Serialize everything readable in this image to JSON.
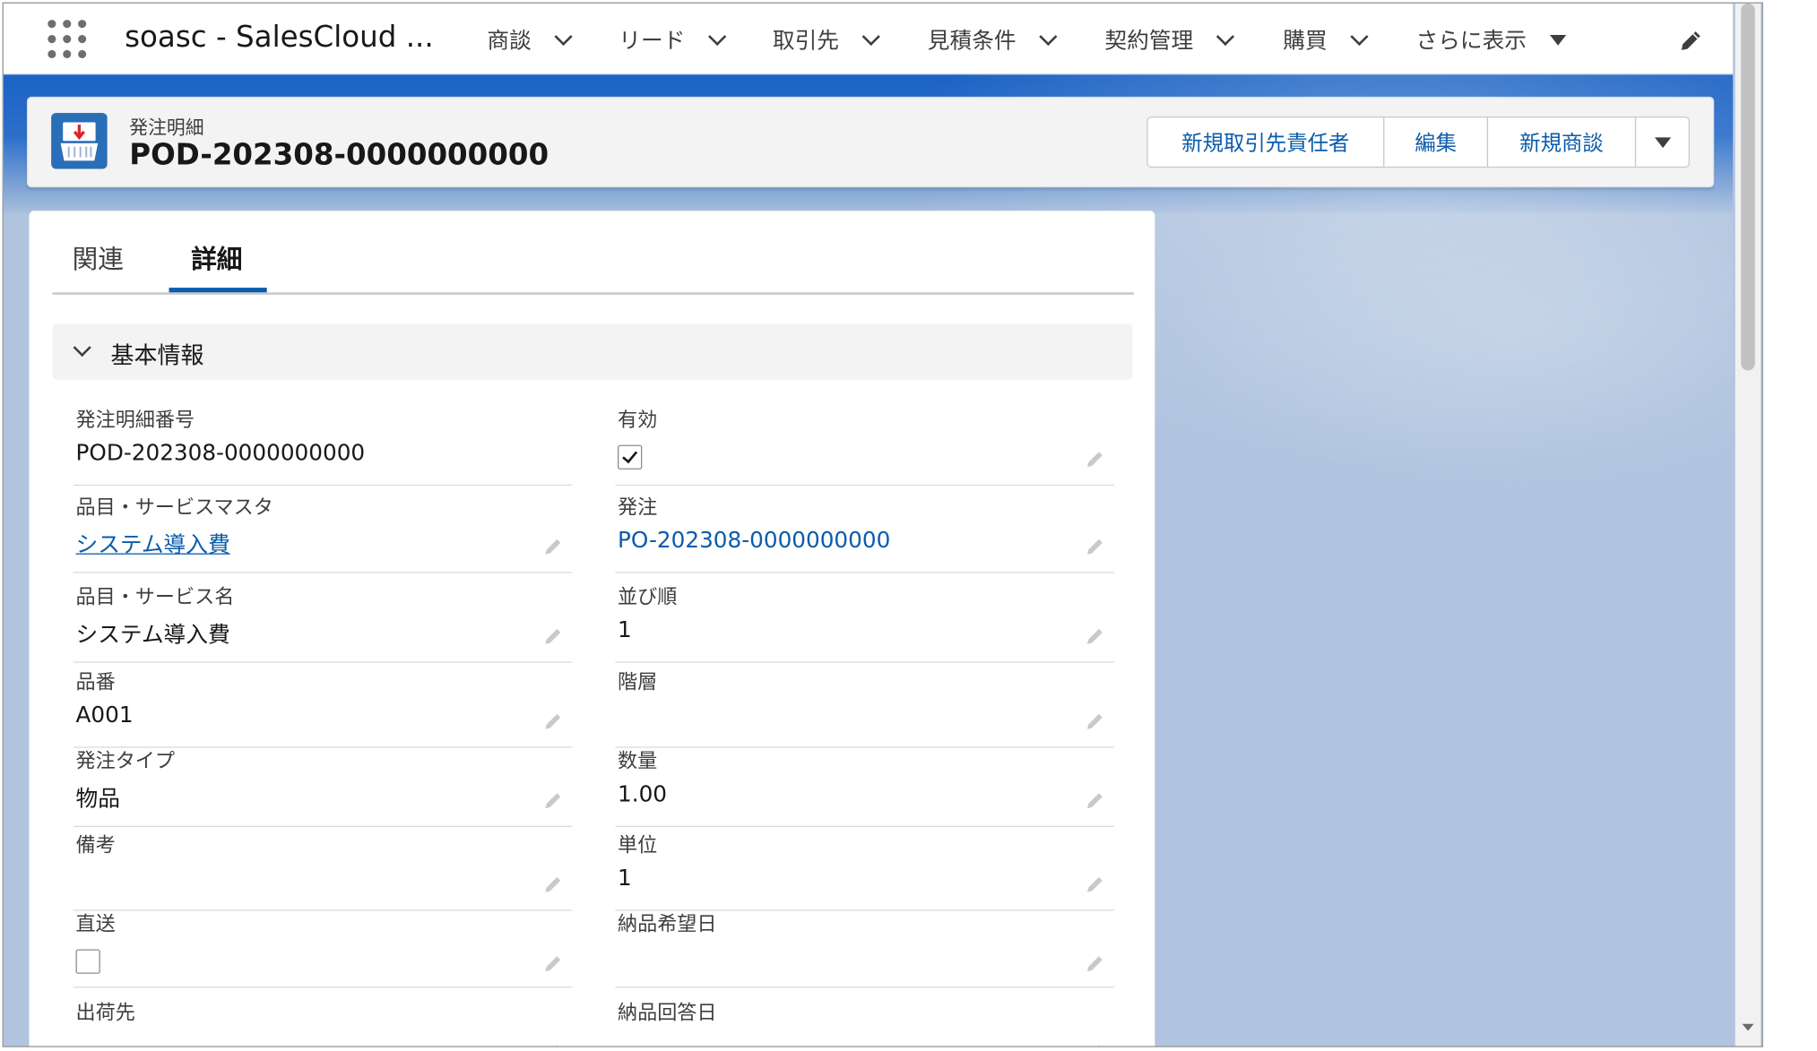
{
  "app": {
    "name": "soasc - SalesCloud ..."
  },
  "nav": {
    "items": [
      "商談",
      "リード",
      "取引先",
      "見積条件",
      "契約管理",
      "購買"
    ],
    "more_label": "さらに表示"
  },
  "record": {
    "object_type": "発注明細",
    "title": "POD-202308-0000000000"
  },
  "actions": {
    "new_contact": "新規取引先責任者",
    "edit": "編集",
    "new_opportunity": "新規商談"
  },
  "tabs": {
    "related": "関連",
    "details": "詳細"
  },
  "section": {
    "title": "基本情報"
  },
  "fields": {
    "line_number": {
      "label": "発注明細番号",
      "value": "POD-202308-0000000000"
    },
    "active": {
      "label": "有効",
      "checked": true
    },
    "product_master": {
      "label": "品目・サービスマスタ",
      "value": "システム導入費"
    },
    "order": {
      "label": "発注",
      "value": "PO-202308-0000000000"
    },
    "product_name": {
      "label": "品目・サービス名",
      "value": "システム導入費"
    },
    "sort_order": {
      "label": "並び順",
      "value": "1"
    },
    "product_code": {
      "label": "品番",
      "value": "A001"
    },
    "hierarchy": {
      "label": "階層",
      "value": ""
    },
    "order_type": {
      "label": "発注タイプ",
      "value": "物品"
    },
    "quantity": {
      "label": "数量",
      "value": "1.00"
    },
    "remarks": {
      "label": "備考",
      "value": ""
    },
    "unit": {
      "label": "単位",
      "value": "1"
    },
    "direct_ship": {
      "label": "直送",
      "checked": false
    },
    "requested_delivery_date": {
      "label": "納品希望日",
      "value": ""
    },
    "ship_to": {
      "label": "出荷先",
      "value": ""
    },
    "confirmed_delivery_date": {
      "label": "納品回答日",
      "value": ""
    }
  },
  "colors": {
    "brand_blue": "#1b62c3",
    "link": "#0b5cab",
    "band_light": "#b0c4df"
  },
  "icons": [
    "app-launcher-icon",
    "chevron-down-icon",
    "pencil-icon",
    "order-line-icon",
    "checkbox-checked-icon"
  ]
}
